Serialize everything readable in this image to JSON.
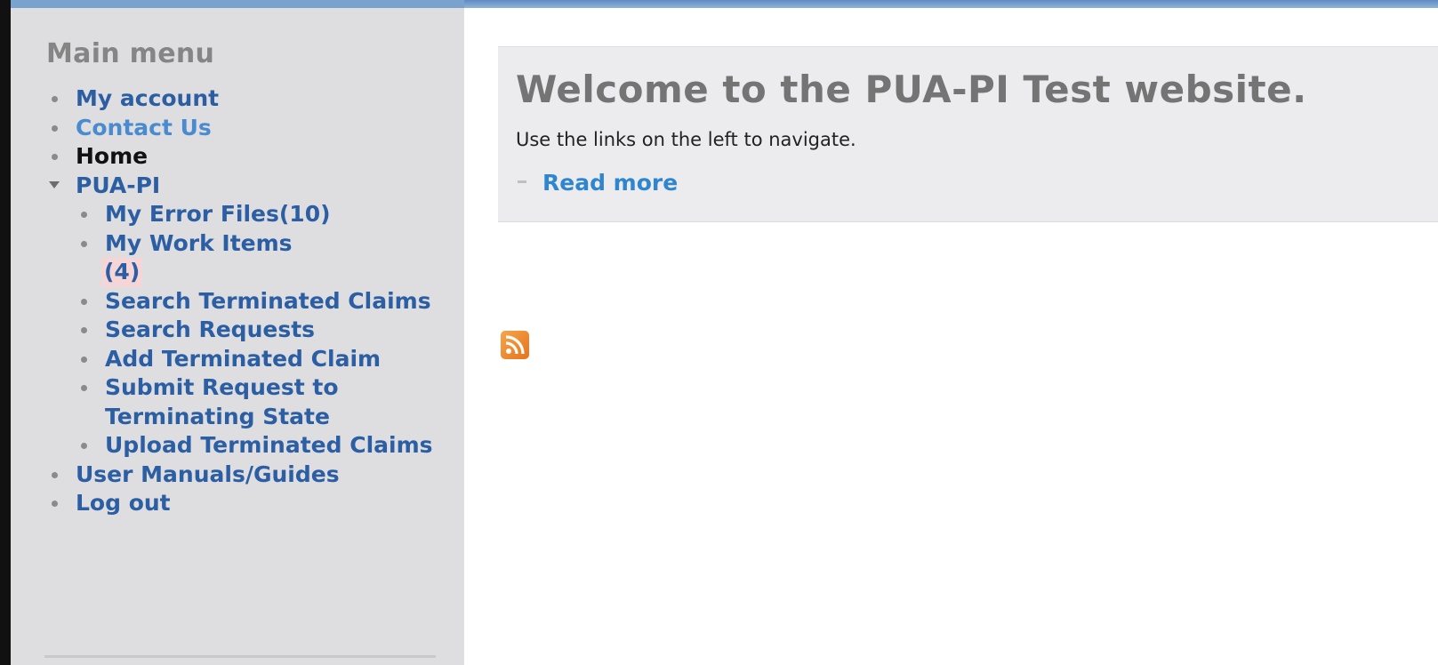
{
  "sidebar": {
    "title": "Main menu",
    "items": [
      {
        "label": "My account"
      },
      {
        "label": "Contact Us"
      },
      {
        "label": "Home"
      },
      {
        "label": "PUA-PI"
      },
      {
        "label": "User Manuals/Guides"
      },
      {
        "label": "Log out"
      }
    ],
    "submenu": [
      {
        "label": "My Error Files(10)"
      },
      {
        "label": "My Work Items",
        "count": "(4)"
      },
      {
        "label": "Search Terminated Claims"
      },
      {
        "label": "Search Requests"
      },
      {
        "label": "Add Terminated Claim"
      },
      {
        "label": "Submit Request to Terminating State"
      },
      {
        "label": "Upload Terminated Claims"
      }
    ]
  },
  "main": {
    "title": "Welcome to the PUA-PI Test website.",
    "body": "Use the links on the left to navigate.",
    "read_more": "Read more"
  },
  "icons": {
    "rss": "rss-feed-icon"
  },
  "colors": {
    "link": "#2c5ea3",
    "sidebar_bg": "#dedee0",
    "content_box_bg": "#ececef",
    "title_gray": "#747474",
    "top_bar": "#7aa2cf",
    "rss_orange": "#e5741c"
  }
}
